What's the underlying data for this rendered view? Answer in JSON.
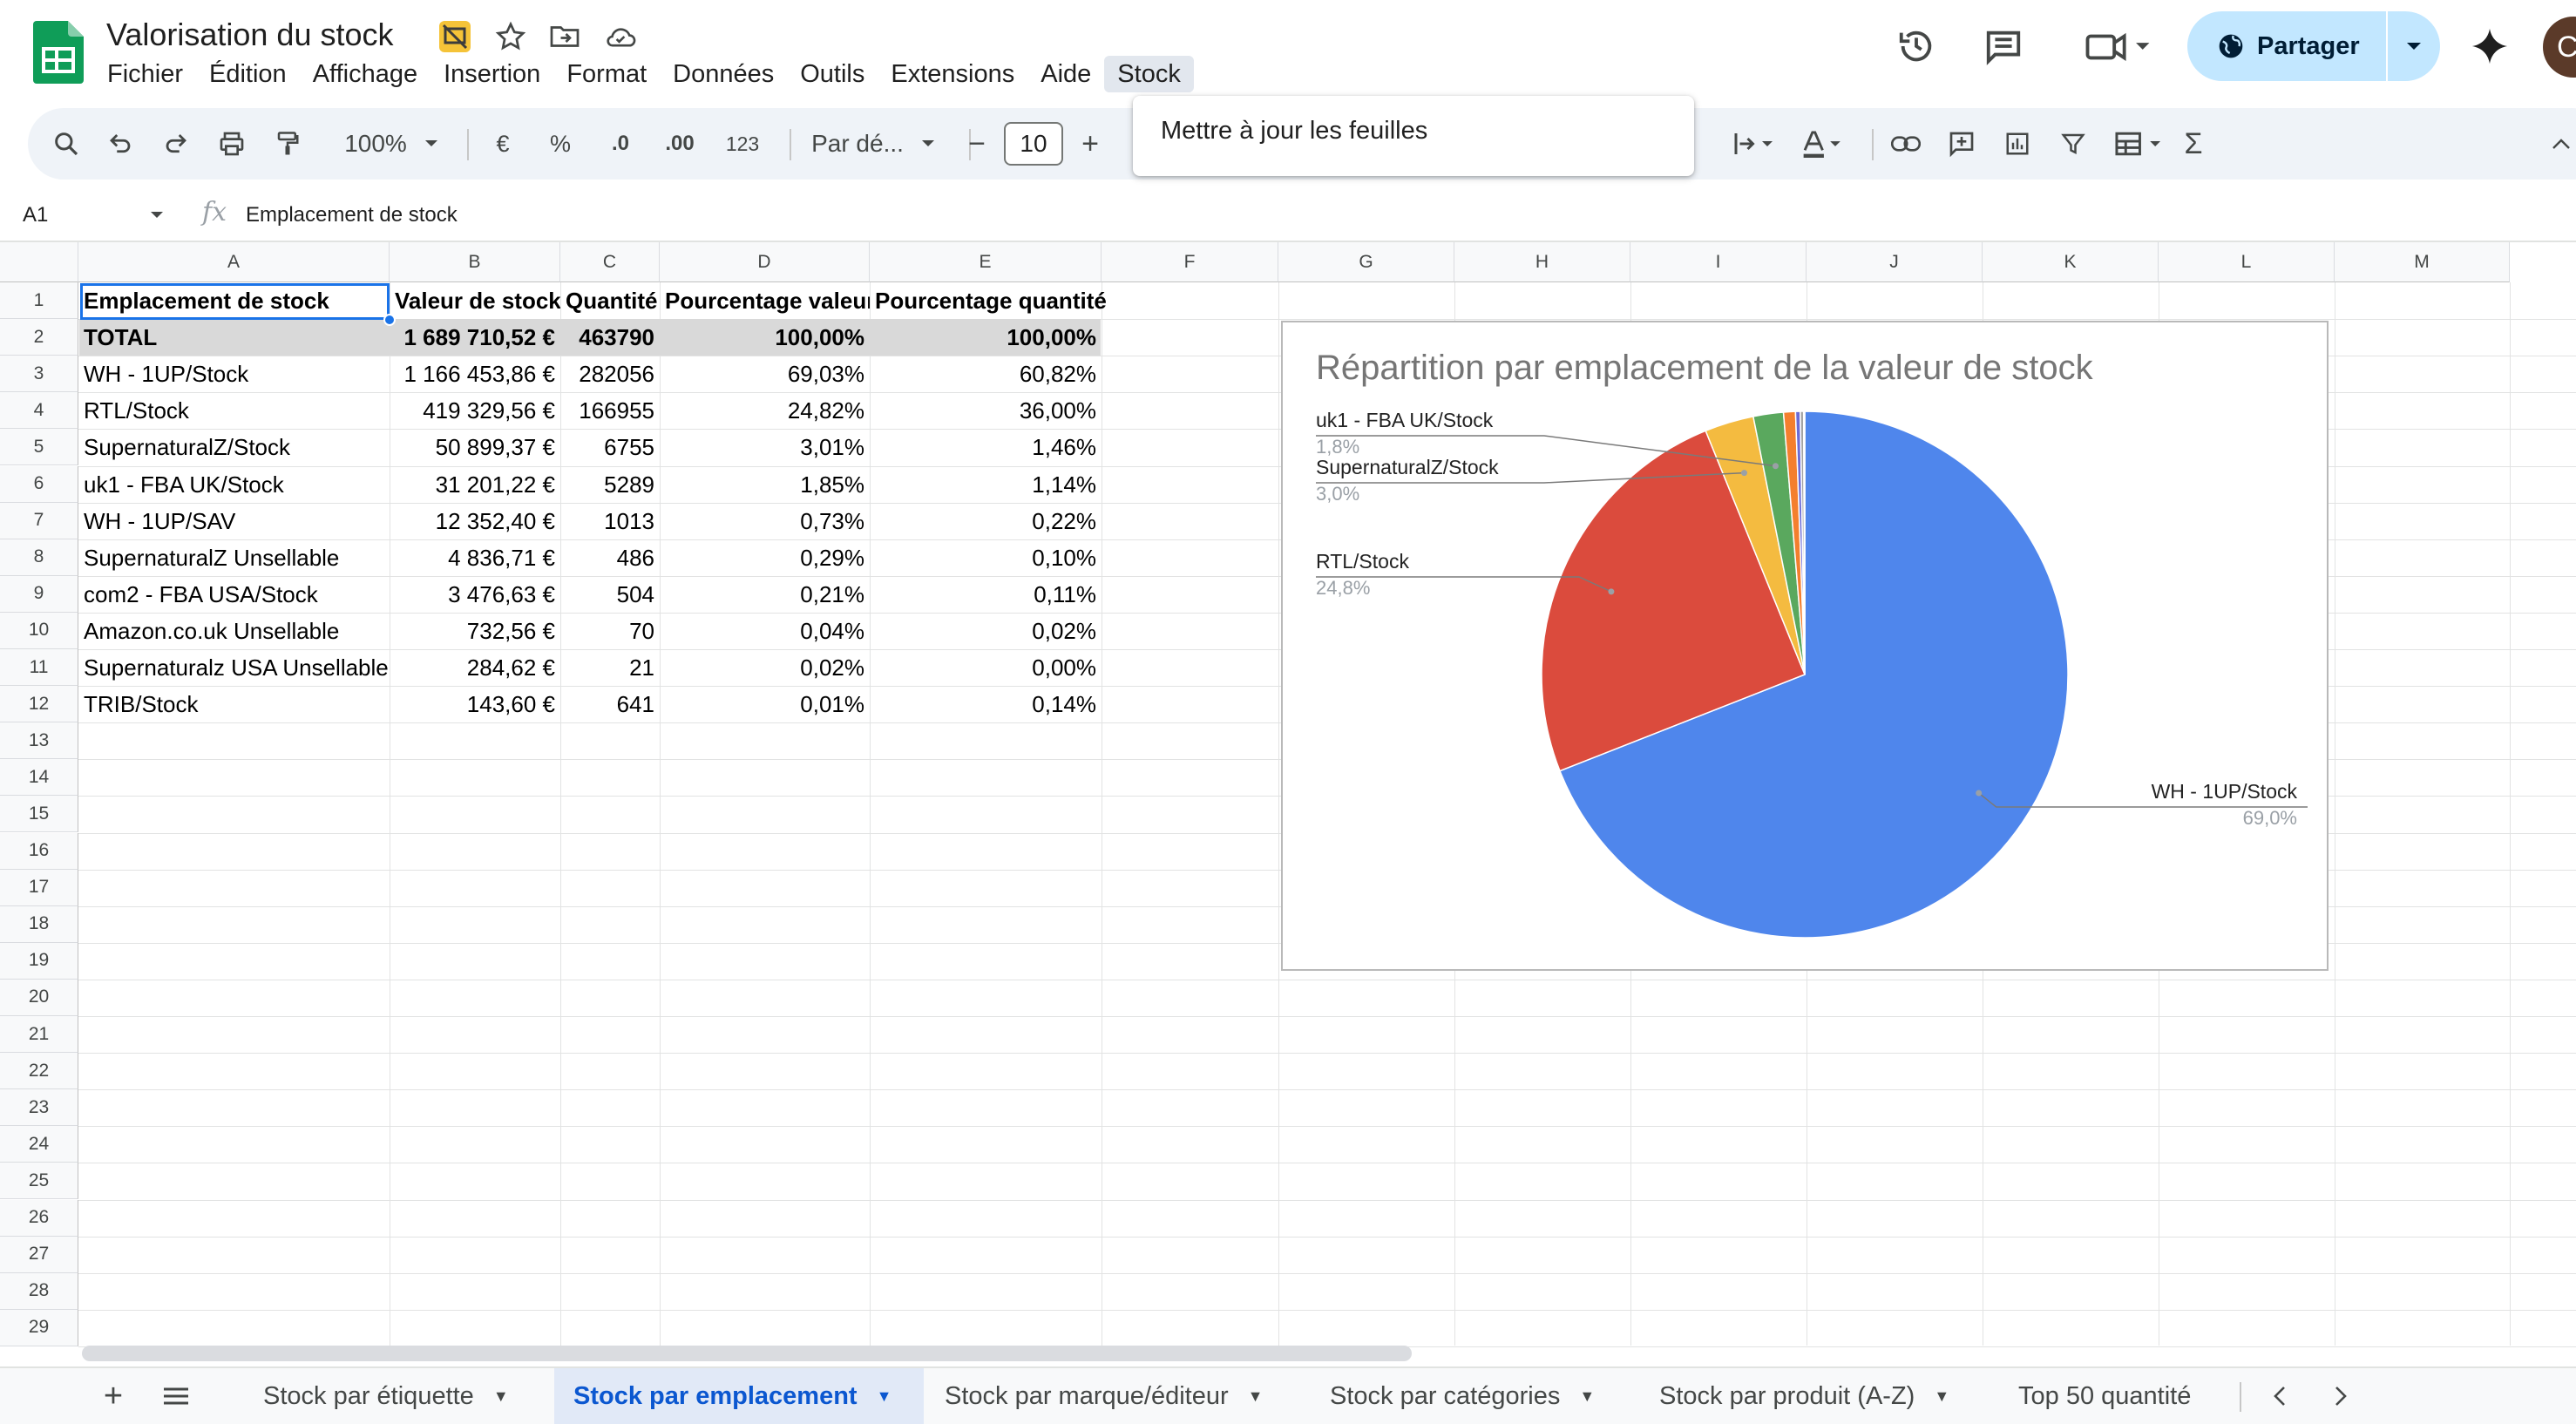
{
  "app": {
    "doc_title": "Valorisation du stock",
    "menu": [
      "Fichier",
      "Édition",
      "Affichage",
      "Insertion",
      "Format",
      "Données",
      "Outils",
      "Extensions",
      "Aide",
      "Stock"
    ],
    "share_label": "Partager",
    "avatar_letter": "C",
    "icons": [
      "sheets-logo",
      "slides-badge-icon",
      "star-icon",
      "move-folder-icon",
      "cloud-saved-icon",
      "history-icon",
      "comment-icon",
      "meet-icon",
      "globe-icon",
      "gemini-icon"
    ]
  },
  "toolbar": {
    "zoom": "100%",
    "currency": "€",
    "percent": "%",
    "dec_minus": ".0",
    "dec_plus": ".00",
    "number_format": "123",
    "font_name": "Par dé...",
    "font_size": "10",
    "minus": "−",
    "plus": "+",
    "sigma": "Σ"
  },
  "dropdown": {
    "item": "Mettre à jour les feuilles"
  },
  "formula_bar": {
    "name_box": "A1",
    "fx": "fx",
    "content": "Emplacement de stock"
  },
  "columns": [
    "A",
    "B",
    "C",
    "D",
    "E",
    "F",
    "G",
    "H",
    "I",
    "J",
    "K",
    "L",
    "M"
  ],
  "rows": [
    "1",
    "2",
    "3",
    "4",
    "5",
    "6",
    "7",
    "8",
    "9",
    "10",
    "11",
    "12",
    "13",
    "14",
    "15",
    "16",
    "17",
    "18",
    "19",
    "20",
    "21",
    "22",
    "23",
    "24",
    "25",
    "26",
    "27",
    "28",
    "29"
  ],
  "table": {
    "header": [
      "Emplacement de stock",
      "Valeur de stock",
      "Quantité",
      "Pourcentage valeur",
      "Pourcentage quantité"
    ],
    "total": [
      "TOTAL",
      "1 689 710,52 €",
      "463790",
      "100,00%",
      "100,00%"
    ],
    "rows": [
      [
        "WH - 1UP/Stock",
        "1 166 453,86 €",
        "282056",
        "69,03%",
        "60,82%"
      ],
      [
        "RTL/Stock",
        "419 329,56 €",
        "166955",
        "24,82%",
        "36,00%"
      ],
      [
        "SupernaturalZ/Stock",
        "50 899,37 €",
        "6755",
        "3,01%",
        "1,46%"
      ],
      [
        "uk1 - FBA UK/Stock",
        "31 201,22 €",
        "5289",
        "1,85%",
        "1,14%"
      ],
      [
        "WH - 1UP/SAV",
        "12 352,40 €",
        "1013",
        "0,73%",
        "0,22%"
      ],
      [
        "SupernaturalZ Unsellable",
        "4 836,71 €",
        "486",
        "0,29%",
        "0,10%"
      ],
      [
        "com2 - FBA USA/Stock",
        "3 476,63 €",
        "504",
        "0,21%",
        "0,11%"
      ],
      [
        "Amazon.co.uk Unsellable",
        "732,56 €",
        "70",
        "0,04%",
        "0,02%"
      ],
      [
        "Supernaturalz USA Unsellable",
        "284,62 €",
        "21",
        "0,02%",
        "0,00%"
      ],
      [
        "TRIB/Stock",
        "143,60 €",
        "641",
        "0,01%",
        "0,14%"
      ]
    ]
  },
  "chart_data": {
    "type": "pie",
    "title": "Répartition par emplacement de la valeur de stock",
    "categories": [
      "WH - 1UP/Stock",
      "RTL/Stock",
      "SupernaturalZ/Stock",
      "uk1 - FBA UK/Stock",
      "WH - 1UP/SAV",
      "SupernaturalZ Unsellable",
      "com2 - FBA USA/Stock",
      "Amazon.co.uk Unsellable",
      "Supernaturalz USA Unsellable",
      "TRIB/Stock"
    ],
    "values": [
      1166453.86,
      419329.56,
      50899.37,
      31201.22,
      12352.4,
      4836.71,
      3476.63,
      732.56,
      284.62,
      143.6
    ],
    "colors": [
      "#4f86ec",
      "#db4b3d",
      "#f4bb40",
      "#5aa85e",
      "#f47f2e",
      "#6b6bd6",
      "#a3a3a3",
      "#4fb4c9",
      "#c5568a",
      "#8fb545"
    ],
    "labels": [
      {
        "name": "WH - 1UP/Stock",
        "pct": "69,0%"
      },
      {
        "name": "RTL/Stock",
        "pct": "24,8%"
      },
      {
        "name": "SupernaturalZ/Stock",
        "pct": "3,0%"
      },
      {
        "name": "uk1 - FBA UK/Stock",
        "pct": "1,8%"
      }
    ],
    "legend": "none"
  },
  "sheet_tabs": [
    {
      "label": "Stock par étiquette",
      "active": false
    },
    {
      "label": "Stock par emplacement",
      "active": true
    },
    {
      "label": "Stock par marque/éditeur",
      "active": false
    },
    {
      "label": "Stock par catégories",
      "active": false
    },
    {
      "label": "Stock par produit (A-Z)",
      "active": false
    },
    {
      "label": "Top 50 quantité",
      "active": false
    }
  ]
}
